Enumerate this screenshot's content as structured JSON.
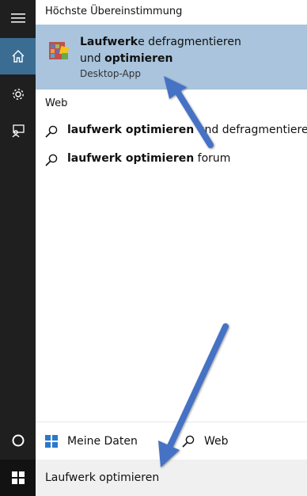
{
  "sidebar": {
    "items": [
      {
        "icon": "hamburger-menu-icon"
      },
      {
        "icon": "home-icon"
      },
      {
        "icon": "gear-icon"
      },
      {
        "icon": "feedback-icon"
      },
      {
        "icon": "cortana-circle-icon"
      },
      {
        "icon": "windows-logo-icon"
      }
    ],
    "active_color": "#3b6d93",
    "background": "#1f1f1f"
  },
  "results": {
    "best_match_header": "Höchste Übereinstimmung",
    "best_match": {
      "title_bold_1": "Laufwerk",
      "title_rest_1": "e defragmentieren",
      "title_rest_2_prefix": "und ",
      "title_bold_2": "optimieren",
      "subtitle": "Desktop-App",
      "highlight_color": "#a9c4dc"
    },
    "web_header": "Web",
    "web_suggestions": [
      {
        "bold": "laufwerk optimieren",
        "rest": " und defragmentieren"
      },
      {
        "bold": "laufwerk optimieren",
        "rest": " forum"
      }
    ]
  },
  "filters": {
    "my_data": "Meine Daten",
    "web": "Web"
  },
  "search": {
    "value": "Laufwerk optimieren"
  },
  "annotations": {
    "arrow_color": "#4472c4"
  }
}
